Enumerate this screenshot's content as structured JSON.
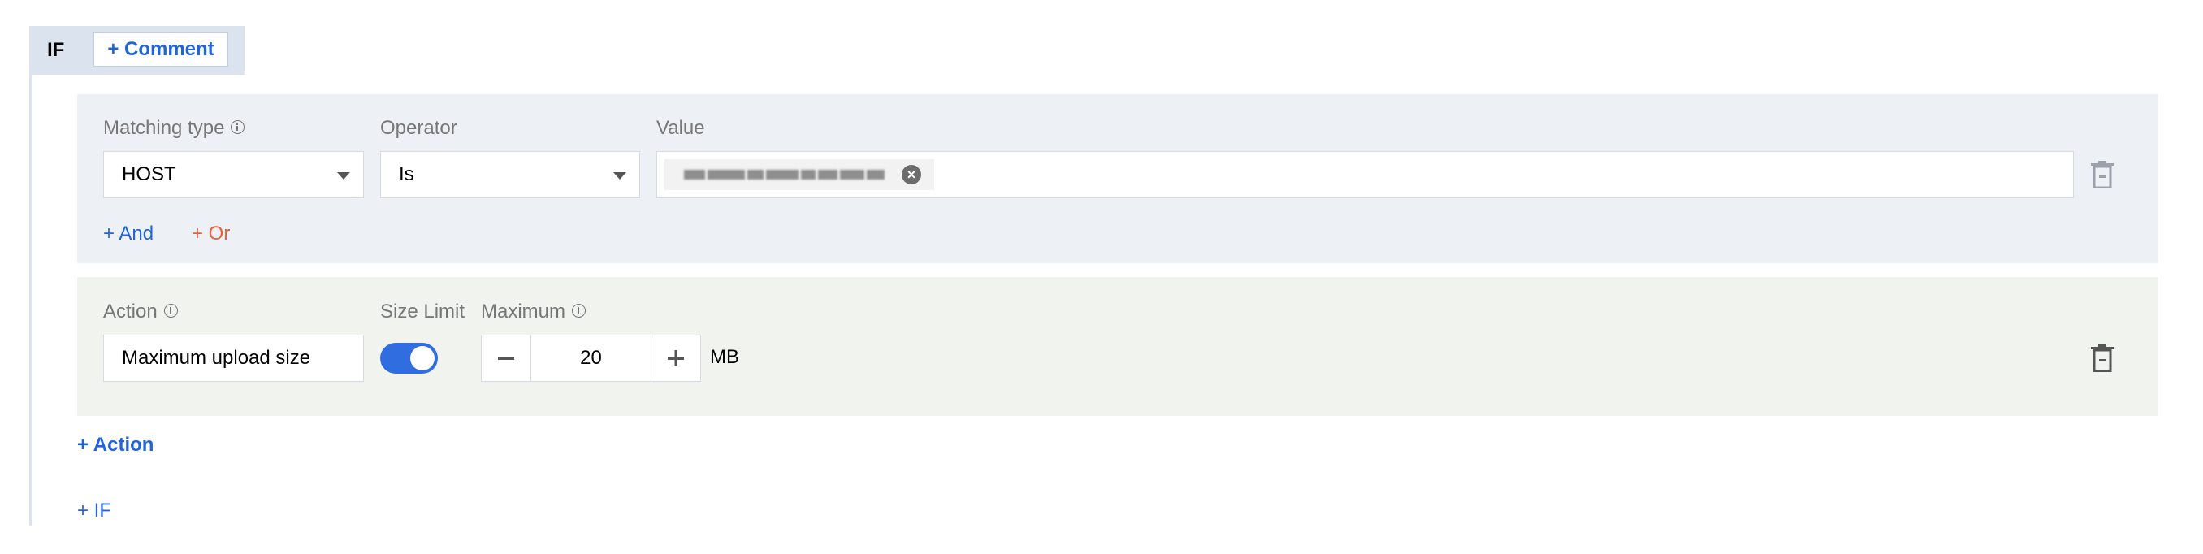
{
  "if_block": {
    "label": "IF",
    "comment_label": "+ Comment"
  },
  "condition": {
    "matching_type_label": "Matching type",
    "matching_type_value": "HOST",
    "operator_label": "Operator",
    "operator_value": "Is",
    "value_label": "Value",
    "and_label": "+ And",
    "or_label": "+ Or"
  },
  "action": {
    "action_label": "Action",
    "action_value": "Maximum upload size",
    "size_limit_label": "Size Limit",
    "size_limit_enabled": true,
    "maximum_label": "Maximum",
    "maximum_value": "20",
    "unit": "MB"
  },
  "add_action_label": "+ Action",
  "add_if_label": "+ IF",
  "colors": {
    "accent_blue": "#2163d9",
    "accent_orange": "#e2643a",
    "toggle_on": "#2f6de0"
  }
}
